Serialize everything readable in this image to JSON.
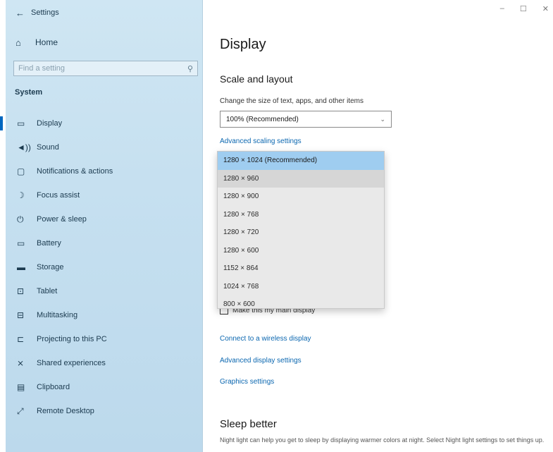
{
  "window": {
    "title": "Settings",
    "controls": [
      "–",
      "☐",
      "✕"
    ]
  },
  "sidebar": {
    "home_label": "Home",
    "search_placeholder": "Find a setting",
    "section_label": "System",
    "items": [
      {
        "label": "Display",
        "icon": "monitor-icon",
        "glyph": "▭",
        "active": true
      },
      {
        "label": "Sound",
        "icon": "sound-icon",
        "glyph": "◄))",
        "active": false
      },
      {
        "label": "Notifications & actions",
        "icon": "notification-icon",
        "glyph": "▢",
        "active": false
      },
      {
        "label": "Focus assist",
        "icon": "moon-icon",
        "glyph": "☽",
        "active": false
      },
      {
        "label": "Power & sleep",
        "icon": "power-icon",
        "glyph": "⏻",
        "active": false
      },
      {
        "label": "Battery",
        "icon": "battery-icon",
        "glyph": "▭",
        "active": false
      },
      {
        "label": "Storage",
        "icon": "storage-icon",
        "glyph": "▬",
        "active": false
      },
      {
        "label": "Tablet",
        "icon": "tablet-icon",
        "glyph": "⊡",
        "active": false
      },
      {
        "label": "Multitasking",
        "icon": "multitasking-icon",
        "glyph": "⊟",
        "active": false
      },
      {
        "label": "Projecting to this PC",
        "icon": "projecting-icon",
        "glyph": "⊏",
        "active": false
      },
      {
        "label": "Shared experiences",
        "icon": "shared-icon",
        "glyph": "⨯",
        "active": false
      },
      {
        "label": "Clipboard",
        "icon": "clipboard-icon",
        "glyph": "▤",
        "active": false
      },
      {
        "label": "Remote Desktop",
        "icon": "remote-icon",
        "glyph": "⤢",
        "active": false
      }
    ]
  },
  "main": {
    "title": "Display",
    "scale_heading": "Scale and layout",
    "scale_desc": "Change the size of text, apps, and other items",
    "scale_value": "100% (Recommended)",
    "advanced_scaling": "Advanced scaling settings",
    "resolutions": [
      "1280 × 1024 (Recommended)",
      "1280 × 960",
      "1280 × 900",
      "1280 × 768",
      "1280 × 720",
      "1280 × 600",
      "1152 × 864",
      "1024 × 768",
      "800 × 600"
    ],
    "selected_resolution_index": 0,
    "hover_resolution_index": 1,
    "main_display_label": "Make this my main display",
    "wireless_link": "Connect to a wireless display",
    "advanced_display": "Advanced display settings",
    "graphics": "Graphics settings",
    "sleep_title": "Sleep better",
    "sleep_desc": "Night light can help you get to sleep by displaying warmer colors at night. Select Night light settings to set things up."
  }
}
